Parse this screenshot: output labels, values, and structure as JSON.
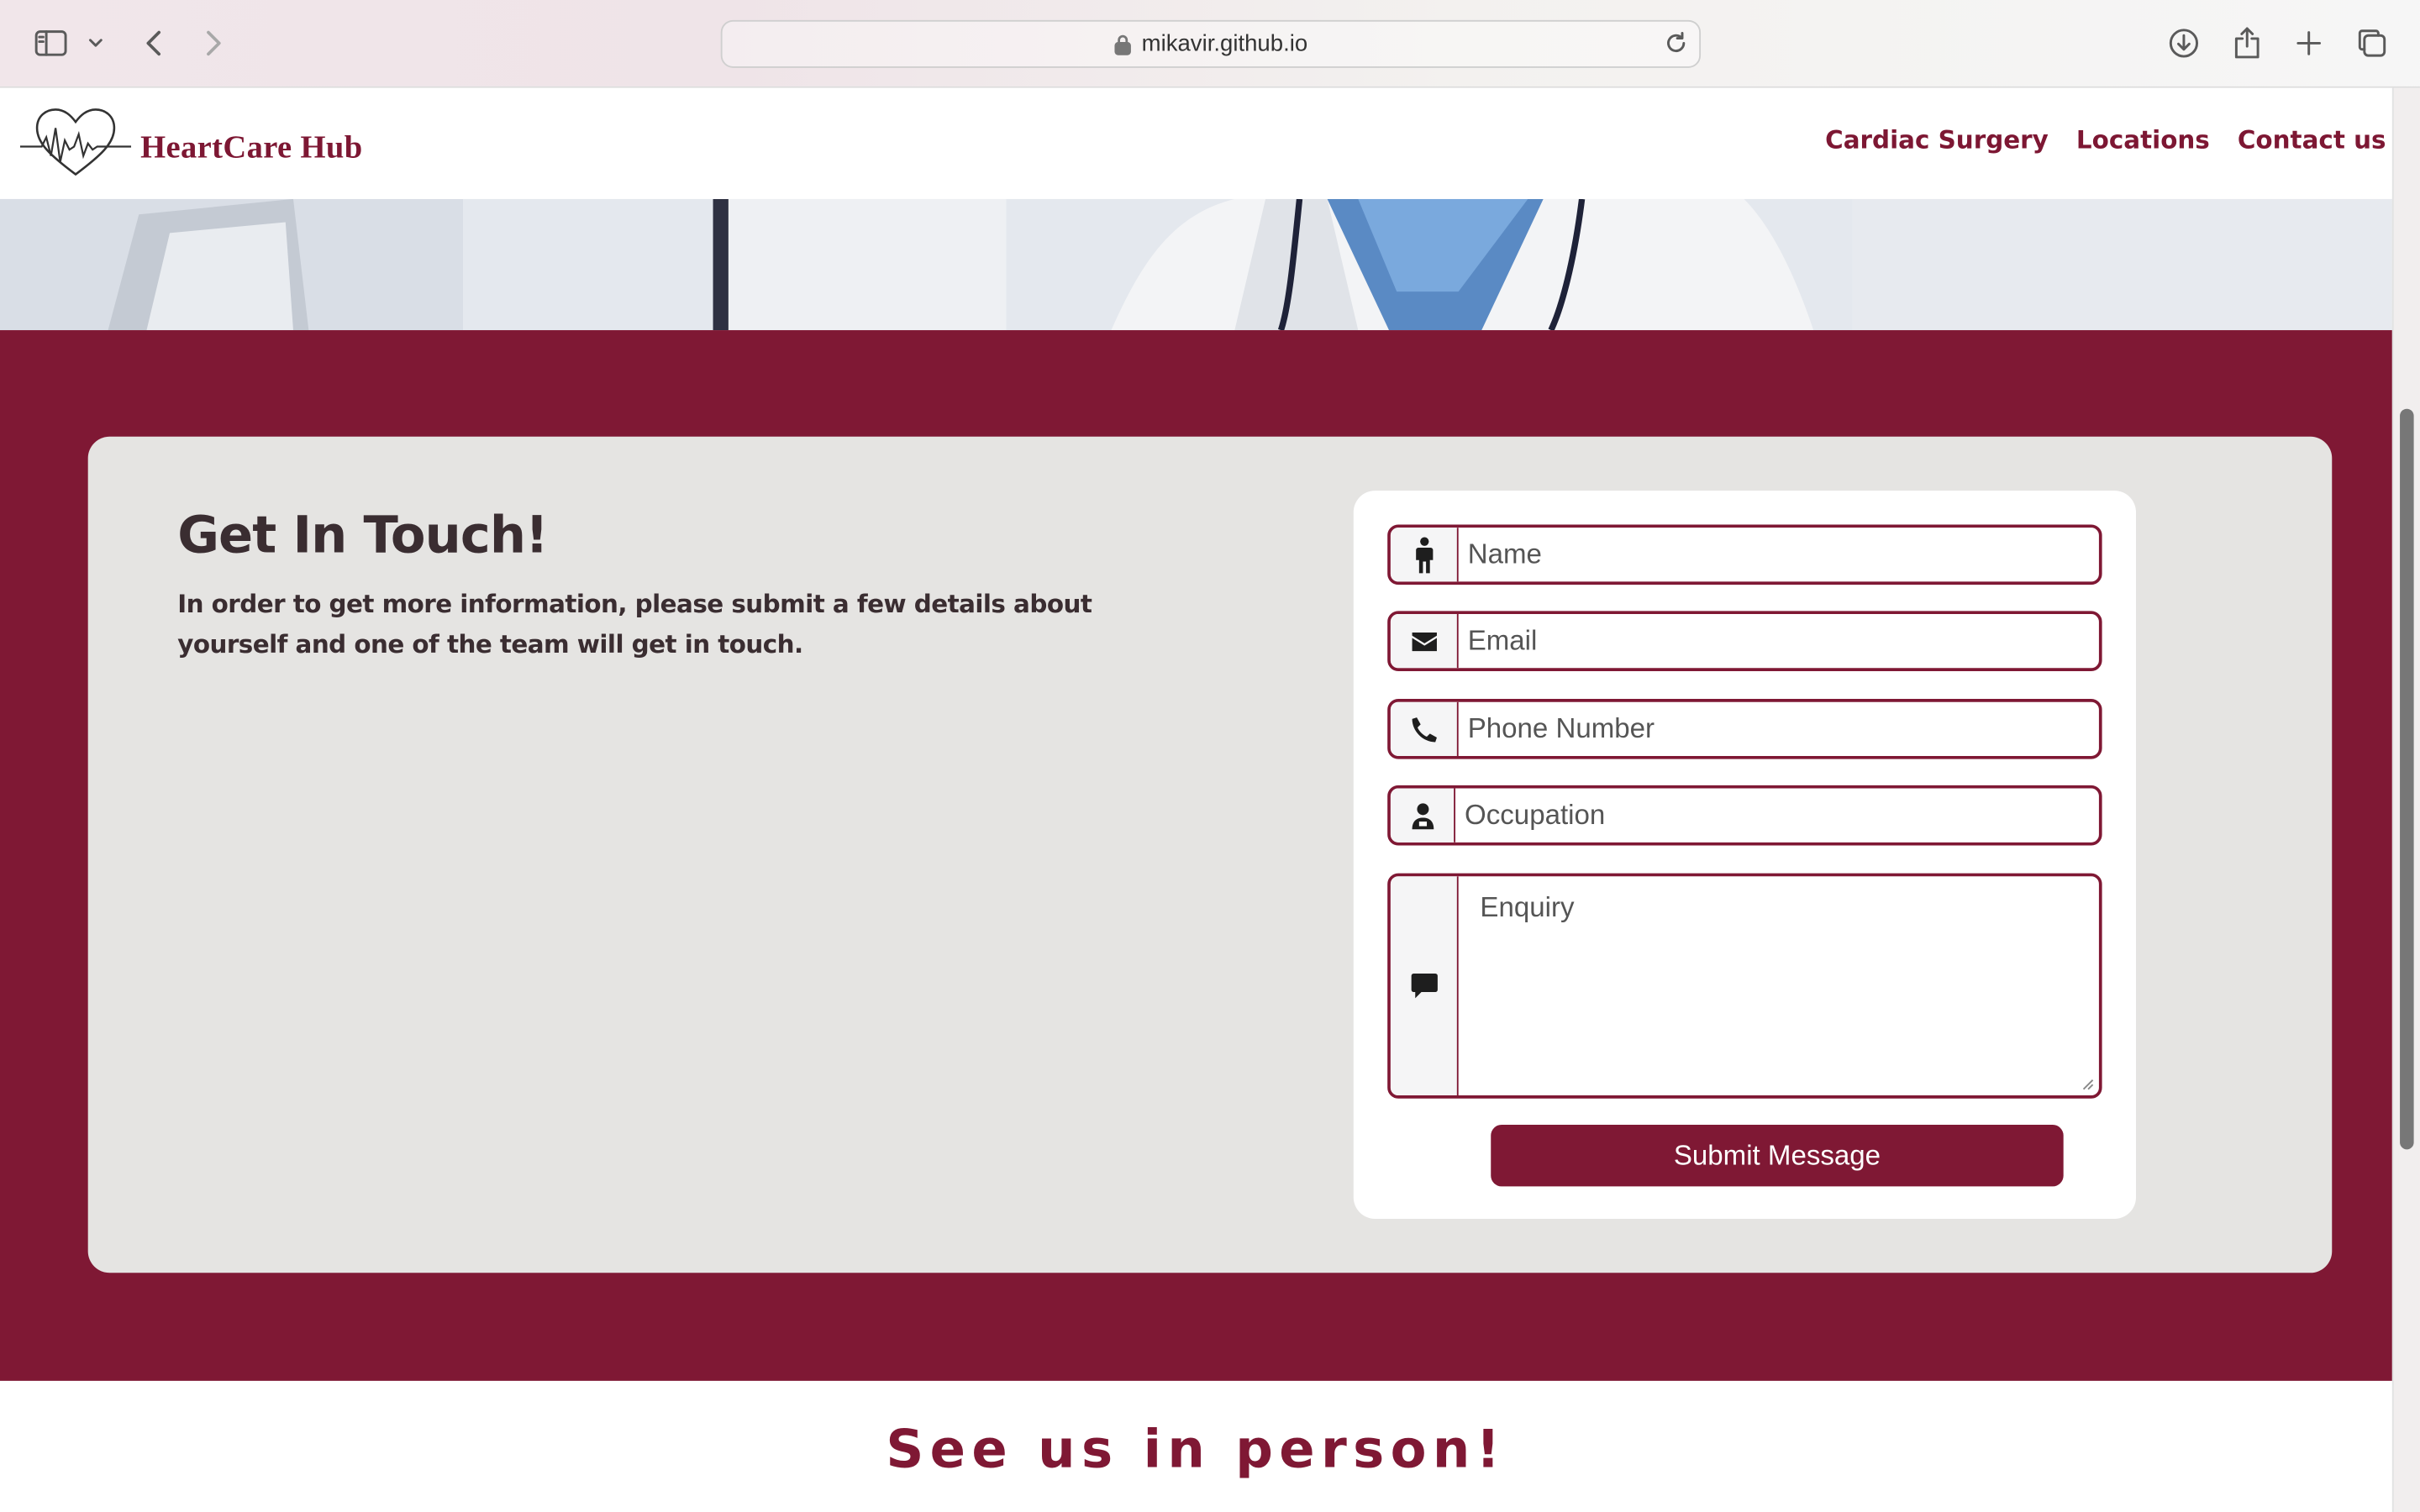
{
  "browser": {
    "url": "mikavir.github.io"
  },
  "site": {
    "logo_text": "HeartCare Hub",
    "nav": [
      {
        "label": "Cardiac Surgery"
      },
      {
        "label": "Locations"
      },
      {
        "label": "Contact us"
      }
    ]
  },
  "contact": {
    "title": "Get In Touch!",
    "description": "In order to get more information, please submit a few details about yourself and one of the team will get in touch.",
    "form": {
      "name_placeholder": "Name",
      "email_placeholder": "Email",
      "phone_placeholder": "Phone Number",
      "occupation_placeholder": "Occupation",
      "enquiry_placeholder": "Enquiry",
      "submit_label": "Submit Message"
    }
  },
  "see_us": {
    "heading": "See us in person!"
  },
  "colors": {
    "brand": "#7f1834",
    "card_bg": "#e5e4e2"
  },
  "icons": [
    "sidebar-icon",
    "chevron-down-icon",
    "back-icon",
    "forward-icon",
    "lock-icon",
    "reload-icon",
    "download-icon",
    "share-icon",
    "new-tab-icon",
    "tabs-icon",
    "heart-pulse-icon",
    "person-icon",
    "envelope-icon",
    "phone-icon",
    "doctor-icon",
    "comment-icon"
  ]
}
